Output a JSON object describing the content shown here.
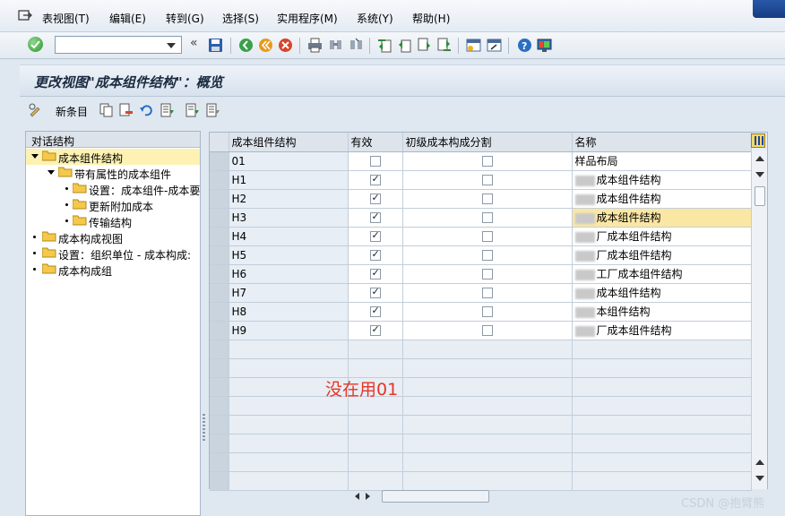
{
  "menubar": {
    "items": [
      "表视图(T)",
      "编辑(E)",
      "转到(G)",
      "选择(S)",
      "实用程序(M)",
      "系统(Y)",
      "帮助(H)"
    ]
  },
  "toolbar": {
    "command_value": "",
    "fast_back": "«",
    "icons": [
      "enter-icon",
      "save-icon",
      "back-icon",
      "exit-icon",
      "cancel-icon",
      "print-icon",
      "find-icon",
      "find-next-icon",
      "first-page-icon",
      "previous-page-icon",
      "next-page-icon",
      "last-page-icon",
      "create-session-icon",
      "shortcut-icon",
      "help-icon",
      "layout-icon"
    ]
  },
  "title": "更改视图\"成本组件结构\"：概览",
  "app_toolbar": {
    "new_entries": "新条目"
  },
  "tree": {
    "header": "对话结构",
    "nodes": [
      {
        "label": "成本组件结构"
      },
      {
        "label": "带有属性的成本组件"
      },
      {
        "label": "设置：成本组件-成本要"
      },
      {
        "label": "更新附加成本"
      },
      {
        "label": "传输结构"
      },
      {
        "label": "成本构成视图"
      },
      {
        "label": "设置：组织单位 - 成本构成:"
      },
      {
        "label": "成本构成组"
      }
    ]
  },
  "grid": {
    "columns": [
      "成本组件结构",
      "有效",
      "初级成本构成分割",
      "名称"
    ],
    "rows": [
      {
        "key": "01",
        "active": false,
        "primary": false,
        "name": "样品布局"
      },
      {
        "key": "H1",
        "active": true,
        "primary": false,
        "name": "成本组件结构"
      },
      {
        "key": "H2",
        "active": true,
        "primary": false,
        "name": "成本组件结构"
      },
      {
        "key": "H3",
        "active": true,
        "primary": false,
        "name": "成本组件结构"
      },
      {
        "key": "H4",
        "active": true,
        "primary": false,
        "name": "厂成本组件结构"
      },
      {
        "key": "H5",
        "active": true,
        "primary": false,
        "name": "厂成本组件结构"
      },
      {
        "key": "H6",
        "active": true,
        "primary": false,
        "name": "工厂成本组件结构"
      },
      {
        "key": "H7",
        "active": true,
        "primary": false,
        "name": "成本组件结构"
      },
      {
        "key": "H8",
        "active": true,
        "primary": false,
        "name": "本组件结构"
      },
      {
        "key": "H9",
        "active": true,
        "primary": false,
        "name": "厂成本组件结构"
      }
    ],
    "empty_rows": 8
  },
  "annotation": "没在用01",
  "watermark": "CSDN @抱臂熊",
  "colors": {
    "highlight_row": "#fbe7a4",
    "selected_tree_node": "#fdf2b3",
    "annotation": "#e53527"
  }
}
